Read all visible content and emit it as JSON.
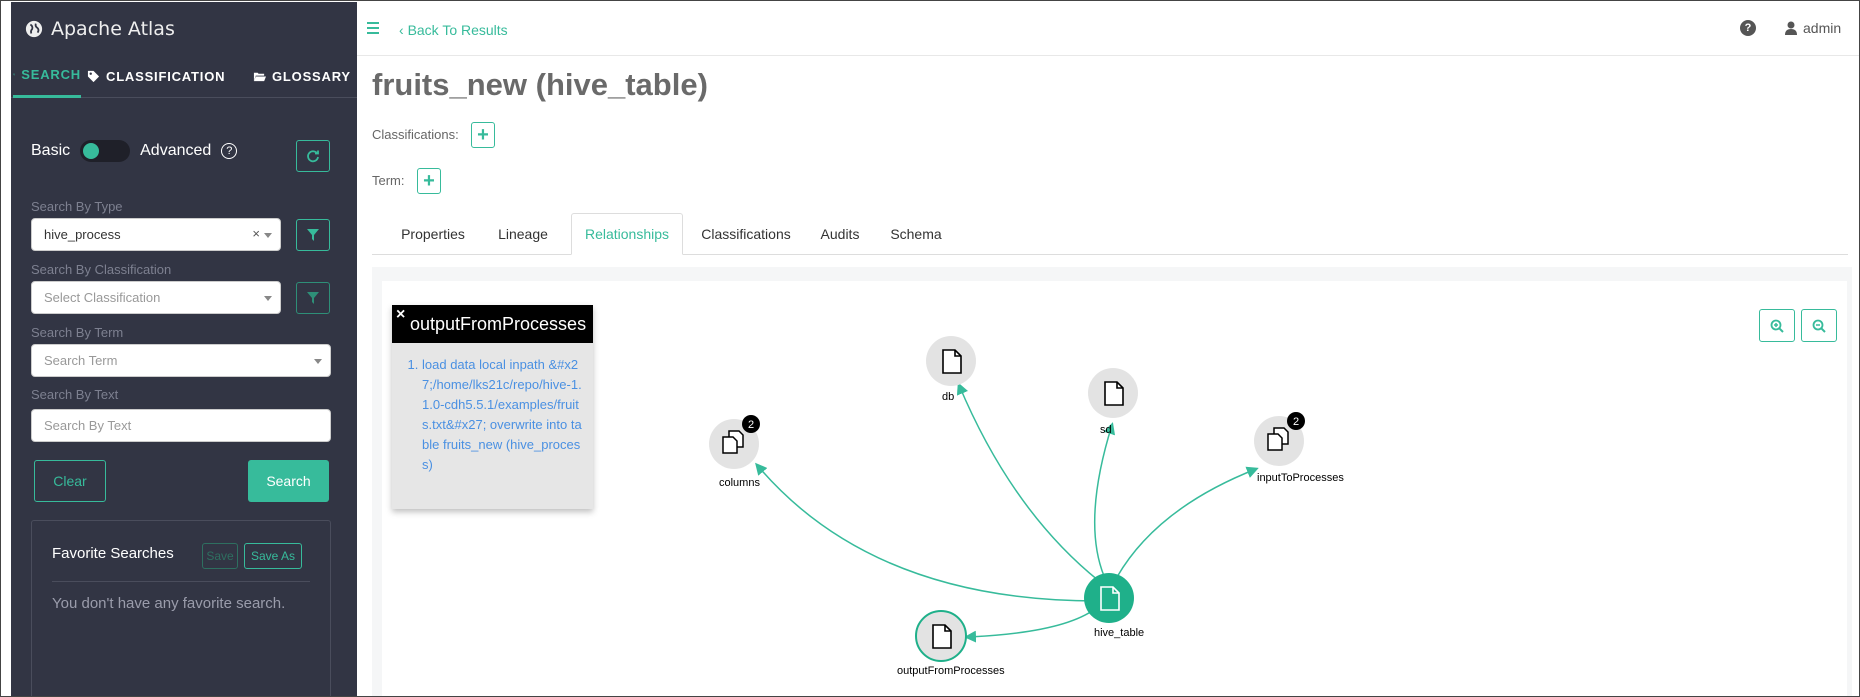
{
  "app": {
    "title": "Apache Atlas"
  },
  "sidebar": {
    "tabs": [
      {
        "label": "SEARCH",
        "icon": "search-icon"
      },
      {
        "label": "CLASSIFICATION",
        "icon": "tags-icon"
      },
      {
        "label": "GLOSSARY",
        "icon": "folder-open-icon"
      }
    ],
    "toggle": {
      "left_label": "Basic",
      "right_label": "Advanced"
    },
    "search_by_type": {
      "label": "Search By Type",
      "value": "hive_process"
    },
    "search_by_classification": {
      "label": "Search By Classification",
      "placeholder": "Select Classification"
    },
    "search_by_term": {
      "label": "Search By Term",
      "placeholder": "Search Term"
    },
    "search_by_text": {
      "label": "Search By Text",
      "placeholder": "Search By Text"
    },
    "clear_label": "Clear",
    "search_label": "Search",
    "favorites": {
      "title": "Favorite Searches",
      "save_label": "Save",
      "save_as_label": "Save As",
      "empty_text": "You don't have any favorite search."
    }
  },
  "topbar": {
    "back_label": "Back To Results",
    "user_label": "admin"
  },
  "entity": {
    "title": "fruits_new (hive_table)",
    "classifications_label": "Classifications:",
    "term_label": "Term:"
  },
  "tabs": [
    {
      "label": "Properties",
      "active": false
    },
    {
      "label": "Lineage",
      "active": false
    },
    {
      "label": "Relationships",
      "active": true
    },
    {
      "label": "Classifications",
      "active": false
    },
    {
      "label": "Audits",
      "active": false
    },
    {
      "label": "Schema",
      "active": false
    }
  ],
  "popup": {
    "title": "outputFromProcesses",
    "items": [
      "load data local inpath &#x27;/home/lks21c/repo/hive-1.1.0-cdh5.5.1/examples/fruits.txt&#x27; overwrite into table fruits_new (hive_process)"
    ]
  },
  "graph": {
    "nodes": [
      {
        "label": "db",
        "icon": "file-icon",
        "badge": ""
      },
      {
        "label": "sd",
        "icon": "file-icon",
        "badge": ""
      },
      {
        "label": "columns",
        "icon": "files-icon",
        "badge": "2"
      },
      {
        "label": "inputToProcesses",
        "icon": "files-icon",
        "badge": "2"
      },
      {
        "label": "hive_table",
        "icon": "file-icon",
        "badge": ""
      },
      {
        "label": "outputFromProcesses",
        "icon": "file-icon",
        "badge": ""
      }
    ]
  },
  "colors": {
    "accent": "#37bb9b",
    "sidebar": "#323544",
    "link": "#4a90e2"
  }
}
